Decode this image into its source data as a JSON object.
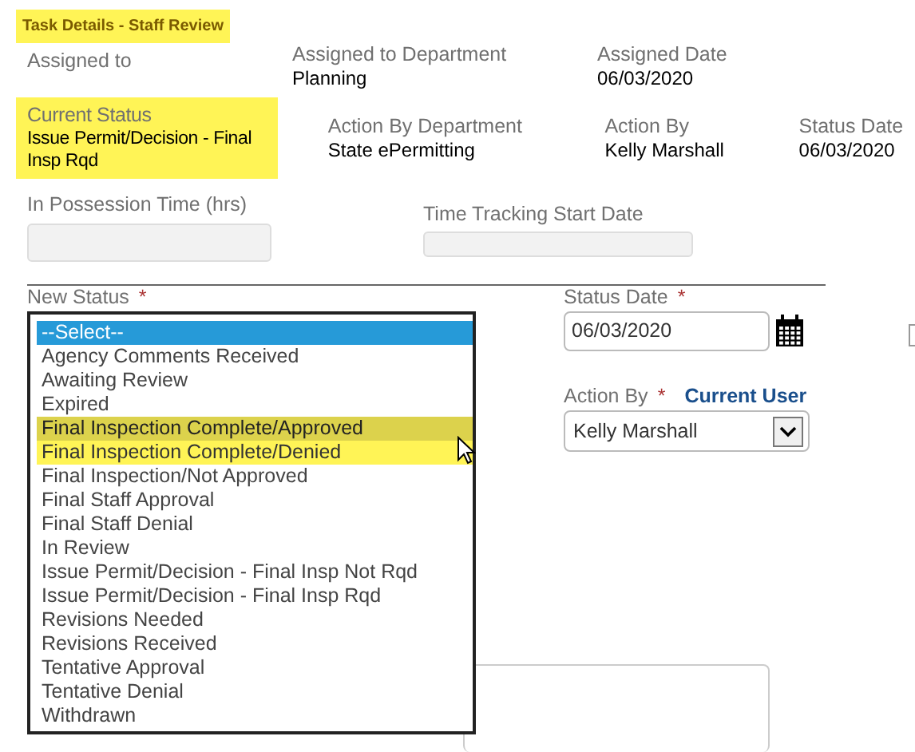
{
  "title": {
    "text": "Task Details - Staff Review",
    "highlighted": true
  },
  "summary_rows": [
    {
      "fields": [
        {
          "label": "Assigned to",
          "highlighted": false
        },
        {
          "label": "Assigned to Department",
          "value": "Planning",
          "highlighted": false
        },
        {
          "label": "Assigned Date",
          "value": "06/03/2020",
          "highlighted": false
        }
      ]
    },
    {
      "fields": [
        {
          "label": "Current Status",
          "value": "Issue Permit/Decision - Final Insp Rqd",
          "highlighted": true
        },
        {
          "label": "Action By Department",
          "value": "State ePermitting",
          "highlighted": false
        },
        {
          "label": "Action By",
          "value": "Kelly Marshall",
          "highlighted": false
        },
        {
          "label": "Status Date",
          "value": "06/03/2020",
          "highlighted": false
        }
      ]
    }
  ],
  "possession_time": {
    "label": "In Possession Time (hrs)",
    "disabled": true
  },
  "tracking_start": {
    "label": "Time Tracking Start Date",
    "disabled": true
  },
  "new_status": {
    "label": "New Status",
    "required": true,
    "expanded": true,
    "options": [
      {
        "text": "--Select--",
        "selected": true,
        "hovered": false,
        "highlighted": false
      },
      {
        "text": "Agency Comments Received",
        "selected": false,
        "hovered": false,
        "highlighted": false
      },
      {
        "text": "Awaiting Review",
        "selected": false,
        "hovered": false,
        "highlighted": false
      },
      {
        "text": "Expired",
        "selected": false,
        "hovered": false,
        "highlighted": false
      },
      {
        "text": "Final Inspection Complete/Approved",
        "selected": false,
        "hovered": true,
        "highlighted": true
      },
      {
        "text": "Final Inspection Complete/Denied",
        "selected": false,
        "hovered": false,
        "highlighted": true
      },
      {
        "text": "Final Inspection/Not Approved",
        "selected": false,
        "hovered": false,
        "highlighted": false
      },
      {
        "text": "Final Staff Approval",
        "selected": false,
        "hovered": false,
        "highlighted": false
      },
      {
        "text": "Final Staff Denial",
        "selected": false,
        "hovered": false,
        "highlighted": false
      },
      {
        "text": "In Review",
        "selected": false,
        "hovered": false,
        "highlighted": false
      },
      {
        "text": "Issue Permit/Decision - Final Insp Not Rqd",
        "selected": false,
        "hovered": false,
        "highlighted": false
      },
      {
        "text": "Issue Permit/Decision - Final Insp Rqd",
        "selected": false,
        "hovered": false,
        "highlighted": false
      },
      {
        "text": "Revisions Needed",
        "selected": false,
        "hovered": false,
        "highlighted": false
      },
      {
        "text": "Revisions Received",
        "selected": false,
        "hovered": false,
        "highlighted": false
      },
      {
        "text": "Tentative Approval",
        "selected": false,
        "hovered": false,
        "highlighted": false
      },
      {
        "text": "Tentative Denial",
        "selected": false,
        "hovered": false,
        "highlighted": false
      },
      {
        "text": "Withdrawn",
        "selected": false,
        "hovered": false,
        "highlighted": false
      }
    ]
  },
  "status_date": {
    "label": "Status Date",
    "required": true,
    "value": "06/03/2020"
  },
  "action_by": {
    "label": "Action By",
    "required": true,
    "link": "Current User",
    "value": "Kelly Marshall"
  },
  "required_mark": "*"
}
